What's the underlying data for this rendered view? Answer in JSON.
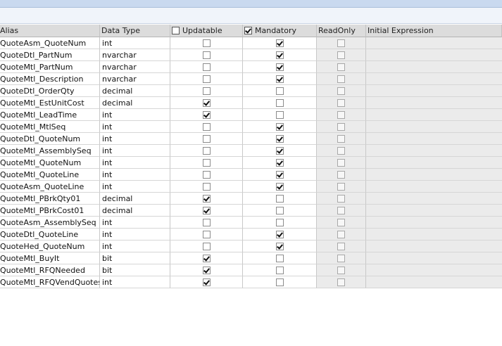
{
  "columns": {
    "alias": "Alias",
    "data_type": "Data Type",
    "updatable": "Updatable",
    "mandatory": "Mandatory",
    "readonly": "ReadOnly",
    "initial_expression": "Initial Expression"
  },
  "header_checks": {
    "updatable": false,
    "mandatory": true
  },
  "rows": [
    {
      "alias": "QuoteAsm_QuoteNum",
      "type": "int",
      "updatable": false,
      "mandatory": true,
      "readonly": false,
      "initial": ""
    },
    {
      "alias": "QuoteDtl_PartNum",
      "type": "nvarchar",
      "updatable": false,
      "mandatory": true,
      "readonly": false,
      "initial": ""
    },
    {
      "alias": "QuoteMtl_PartNum",
      "type": "nvarchar",
      "updatable": false,
      "mandatory": true,
      "readonly": false,
      "initial": ""
    },
    {
      "alias": "QuoteMtl_Description",
      "type": "nvarchar",
      "updatable": false,
      "mandatory": true,
      "readonly": false,
      "initial": ""
    },
    {
      "alias": "QuoteDtl_OrderQty",
      "type": "decimal",
      "updatable": false,
      "mandatory": false,
      "readonly": false,
      "initial": ""
    },
    {
      "alias": "QuoteMtl_EstUnitCost",
      "type": "decimal",
      "updatable": true,
      "mandatory": false,
      "readonly": false,
      "initial": ""
    },
    {
      "alias": "QuoteMtl_LeadTime",
      "type": "int",
      "updatable": true,
      "mandatory": false,
      "readonly": false,
      "initial": ""
    },
    {
      "alias": "QuoteMtl_MtlSeq",
      "type": "int",
      "updatable": false,
      "mandatory": true,
      "readonly": false,
      "initial": ""
    },
    {
      "alias": "QuoteDtl_QuoteNum",
      "type": "int",
      "updatable": false,
      "mandatory": true,
      "readonly": false,
      "initial": ""
    },
    {
      "alias": "QuoteMtl_AssemblySeq",
      "type": "int",
      "updatable": false,
      "mandatory": true,
      "readonly": false,
      "initial": ""
    },
    {
      "alias": "QuoteMtl_QuoteNum",
      "type": "int",
      "updatable": false,
      "mandatory": true,
      "readonly": false,
      "initial": ""
    },
    {
      "alias": "QuoteMtl_QuoteLine",
      "type": "int",
      "updatable": false,
      "mandatory": true,
      "readonly": false,
      "initial": ""
    },
    {
      "alias": "QuoteAsm_QuoteLine",
      "type": "int",
      "updatable": false,
      "mandatory": true,
      "readonly": false,
      "initial": ""
    },
    {
      "alias": "QuoteMtl_PBrkQty01",
      "type": "decimal",
      "updatable": true,
      "mandatory": false,
      "readonly": false,
      "initial": ""
    },
    {
      "alias": "QuoteMtl_PBrkCost01",
      "type": "decimal",
      "updatable": true,
      "mandatory": false,
      "readonly": false,
      "initial": ""
    },
    {
      "alias": "QuoteAsm_AssemblySeq",
      "type": "int",
      "updatable": false,
      "mandatory": false,
      "readonly": false,
      "initial": ""
    },
    {
      "alias": "QuoteDtl_QuoteLine",
      "type": "int",
      "updatable": false,
      "mandatory": true,
      "readonly": false,
      "initial": ""
    },
    {
      "alias": "QuoteHed_QuoteNum",
      "type": "int",
      "updatable": false,
      "mandatory": true,
      "readonly": false,
      "initial": ""
    },
    {
      "alias": "QuoteMtl_BuyIt",
      "type": "bit",
      "updatable": true,
      "mandatory": false,
      "readonly": false,
      "initial": ""
    },
    {
      "alias": "QuoteMtl_RFQNeeded",
      "type": "bit",
      "updatable": true,
      "mandatory": false,
      "readonly": false,
      "initial": ""
    },
    {
      "alias": "QuoteMtl_RFQVendQuotes",
      "type": "int",
      "updatable": true,
      "mandatory": false,
      "readonly": false,
      "initial": ""
    }
  ]
}
